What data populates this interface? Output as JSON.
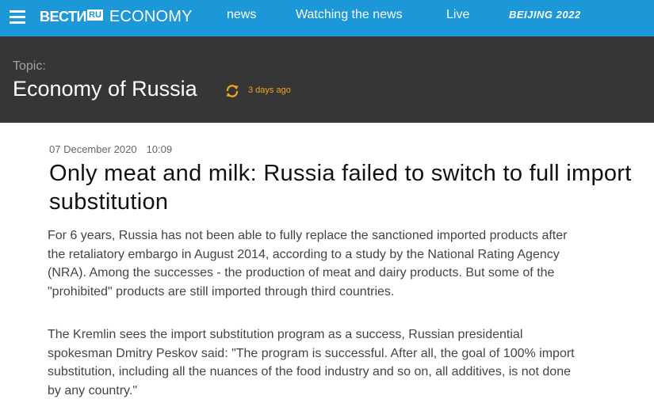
{
  "header": {
    "brand": "ВЕСТИ",
    "brand_badge": "RU",
    "section": "ECONOMY",
    "nav": [
      "news",
      "Watching the news",
      "Live"
    ],
    "special": "BEIJING 2022"
  },
  "topic": {
    "label": "Topic:",
    "title": "Economy of Russia",
    "updated": "3 days ago",
    "accent_color": "#f3a41a"
  },
  "article": {
    "date": "07 December 2020",
    "time": "10:09",
    "title": "Only meat and milk: Russia failed to switch to full import substitution",
    "paragraphs": [
      "For 6 years, Russia has not been able to fully replace the sanctioned imported products after the retaliatory embargo in August 2014, according to a study by the National Rating Agency (NRA). Among the successes - the production of meat and dairy products. But some of the \"prohibited\" products are still imported through third countries.",
      "The Kremlin sees the import substitution program as a success, Russian presidential spokesman Dmitry Peskov said: \"The program is successful. After all, the goal of 100% import substitution, including all the nuances of the food industry and so on, all additives, is not done by any country.\""
    ]
  },
  "colors": {
    "header_bg": "#1c98d8",
    "topic_bg": "#363636"
  },
  "icons": {
    "menu": "hamburger-menu-icon",
    "refresh": "refresh-icon"
  }
}
